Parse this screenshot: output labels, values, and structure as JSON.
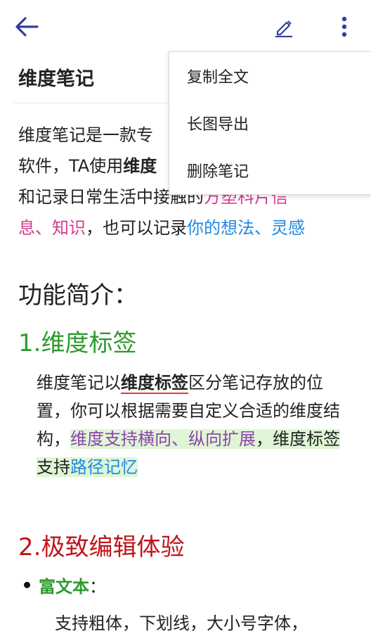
{
  "toolbar": {
    "back_icon": "arrow-left-icon",
    "edit_icon": "pencil-icon",
    "more_icon": "more-vert-icon",
    "icon_color": "#2f3f9e"
  },
  "note": {
    "title": "维度笔记",
    "intro": {
      "t1": "维度笔记是一款专",
      "t2": "软件，TA使用",
      "t3": "维度",
      "t4": "和记录日常生活中接触的",
      "t5": "方塑科片信",
      "t6": "息、知识",
      "t7": "，也可以记录",
      "t8": "你的想法、灵感"
    },
    "section_func": "功能简介：",
    "section1": {
      "heading": "1.维度标签",
      "p1": "维度笔记以",
      "p2": "维度标签",
      "p3": "区分笔记存放的位置，你可以根据需要自定义合适的维度结构，",
      "p4": "维度支持横向、纵向扩展",
      "p5": "，维度标签支持",
      "p6": "路径记忆"
    },
    "section2": {
      "heading": "2.极致编辑体验",
      "bullet_label": "富文本",
      "bullet_colon": "：",
      "p1": "支持粗体，下划线，大小号字体，"
    }
  },
  "menu": {
    "items": [
      {
        "label": "复制全文"
      },
      {
        "label": "长图导出"
      },
      {
        "label": "删除笔记"
      }
    ]
  }
}
